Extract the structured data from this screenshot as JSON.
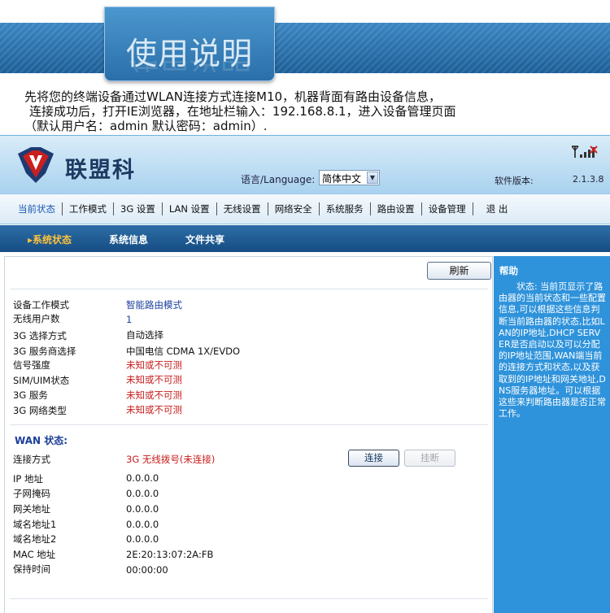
{
  "banner": {
    "title": "使用说明"
  },
  "intro": {
    "line1": "先将您的终端设备通过WLAN连接方式连接M10，机器背面有路由设备信息，",
    "line2": "连接成功后，打开IE浏览器，在地址栏输入：192.168.8.1，进入设备管理页面",
    "line3": "（默认用户名：admin 默认密码：admin）."
  },
  "header": {
    "logo_text": "联盟科",
    "language_label": "语言/Language:",
    "language_selected": "简体中文",
    "software_version_label": "软件版本:",
    "software_version": "2.1.3.8",
    "signal_icon": "signal-bars-icon",
    "logo_icon": "shield-v-logo-icon"
  },
  "main_nav": {
    "items": [
      "当前状态",
      "工作模式",
      "3G 设置",
      "LAN 设置",
      "无线设置",
      "网络安全",
      "系统服务",
      "路由设置",
      "设备管理",
      "退 出"
    ],
    "active": "当前状态"
  },
  "sub_nav": {
    "items": [
      "系统状态",
      "系统信息",
      "文件共享"
    ],
    "active": "系统状态",
    "active_marker": "▸"
  },
  "device_status": {
    "refresh_label": "刷新",
    "rows": [
      {
        "label": "设备工作模式",
        "value": "智能路由模式",
        "color": "blue"
      },
      {
        "label": "无线用户数",
        "value": "1",
        "color": "blue"
      },
      {
        "label": "3G 选择方式",
        "value": "自动选择",
        "color": "black"
      },
      {
        "label": "3G 服务商选择",
        "value": "中国电信  CDMA 1X/EVDO",
        "color": "black"
      },
      {
        "label": "信号强度",
        "value": "未知或不可测",
        "color": "red"
      },
      {
        "label": "SIM/UIM状态",
        "value": "未知或不可测",
        "color": "red"
      },
      {
        "label": "3G 服务",
        "value": "未知或不可测",
        "color": "red"
      },
      {
        "label": "3G 网络类型",
        "value": "未知或不可测",
        "color": "red"
      }
    ]
  },
  "wan_status": {
    "title": "WAN 状态:",
    "connection_label": "连接方式",
    "connection_value": "3G 无线拨号(未连接)",
    "connect_label": "连接",
    "disconnect_label": "挂断",
    "rows": [
      {
        "label": "IP 地址",
        "value": "0.0.0.0"
      },
      {
        "label": "子网掩码",
        "value": "0.0.0.0"
      },
      {
        "label": "网关地址",
        "value": "0.0.0.0"
      },
      {
        "label": "域名地址1",
        "value": "0.0.0.0"
      },
      {
        "label": "域名地址2",
        "value": "0.0.0.0"
      },
      {
        "label": "MAC 地址",
        "value": "2E:20:13:07:2A:FB"
      },
      {
        "label": "保持时间",
        "value": "00:00:00"
      }
    ]
  },
  "help": {
    "title": "帮助",
    "body": "状态: 当前页显示了路由器的当前状态和一些配置信息,可以根据这些信息判断当前路由器的状态,比如LAN的IP地址,DHCP SERVER是否启动以及可以分配的IP地址范围,WAN端当前的连接方式和状态,以及获取到的IP地址和网关地址,DNS服务器地址。可以根据这些来判断路由器是否正常工作。"
  },
  "colors": {
    "banner_blue": "#2a73b0",
    "help_blue": "#2f93db",
    "subnav_blue": "#1a568f",
    "active_orange": "#ffc23a",
    "value_blue": "#1c3f9e",
    "value_red": "#c81b1b"
  }
}
